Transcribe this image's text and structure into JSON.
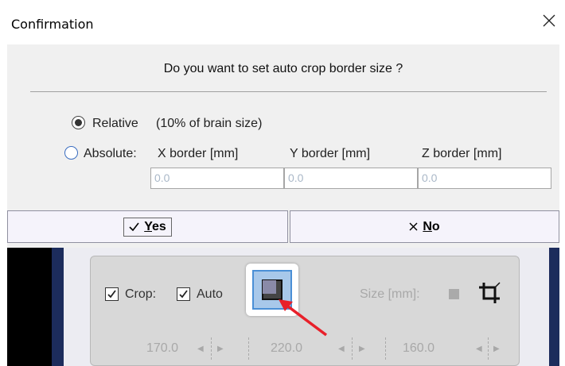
{
  "window": {
    "title": "Confirmation"
  },
  "dialog": {
    "question": "Do you want to set auto crop border size ?",
    "relative": {
      "label": "Relative",
      "note": "(10% of brain size)",
      "checked": true
    },
    "absolute": {
      "label": "Absolute:",
      "checked": false
    },
    "fields": [
      {
        "label": "X border [mm]",
        "value": "0.0"
      },
      {
        "label": "Y border [mm]",
        "value": "0.0"
      },
      {
        "label": "Z border [mm]",
        "value": "0.0"
      }
    ],
    "buttons": {
      "yes_mnemonic": "Y",
      "yes_rest": "es",
      "no_mnemonic": "N",
      "no_rest": "o"
    }
  },
  "background": {
    "crop_label": "Crop:",
    "auto_label": "Auto",
    "size_label": "Size [mm]:",
    "spin_values": [
      "170.0",
      "220.0",
      "160.0"
    ]
  },
  "colors": {
    "annotation_arrow": "#e8202a",
    "dialog_bg": "#f0f0f0",
    "button_bg": "#f5f3fb"
  }
}
